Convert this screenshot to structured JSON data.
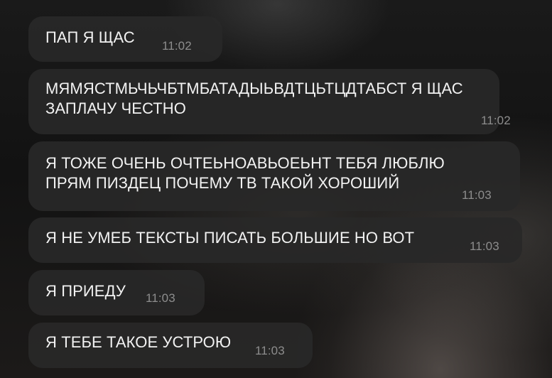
{
  "messages": [
    {
      "text": "ПАП Я ЩАС",
      "time": "11:02"
    },
    {
      "text": "МЯМЯСТМЬЧЬЧБТМБАТАДЫЬВДТЦЬТЦДТАБСТ Я ЩАС\nЗАПЛАЧУ ЧЕСТНО",
      "time": "11:02"
    },
    {
      "text": "Я ТОЖЕ ОЧЕНЬ ОЧТЕЬНОАВЬОЕЬНТ ТЕБЯ ЛЮБЛЮ\nПРЯМ ПИЗДЕЦ ПОЧЕМУ ТВ ТАКОЙ ХОРОШИЙ",
      "time": "11:03"
    },
    {
      "text": "Я НЕ УМЕБ ТЕКСТЫ ПИСАТЬ БОЛЬШИЕ НО ВОТ",
      "time": "11:03"
    },
    {
      "text": "Я ПРИЕДУ",
      "time": "11:03"
    },
    {
      "text": "Я ТЕБЕ ТАКОЕ УСТРОЮ",
      "time": "11:03"
    }
  ]
}
